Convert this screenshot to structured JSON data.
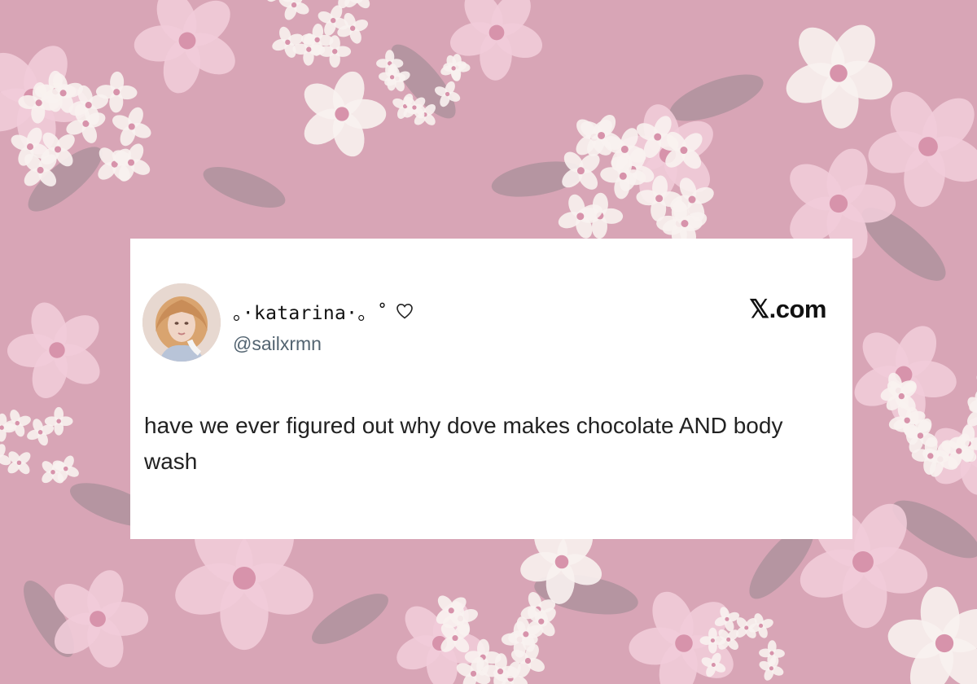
{
  "tweet": {
    "display_name": "。·katarina·。˚",
    "handle": "@sailxrmn",
    "brand": "𝕏.com",
    "text": "have we ever figured out why dove makes chocolate AND body wash",
    "avatar_icon": "profile-photo",
    "heart_icon": "heart-outline"
  },
  "background": {
    "base_color": "#d59eb0",
    "petal_pink": "#efc8d6",
    "petal_white": "#f8f1ee",
    "leaf_color": "#8f7e86"
  }
}
